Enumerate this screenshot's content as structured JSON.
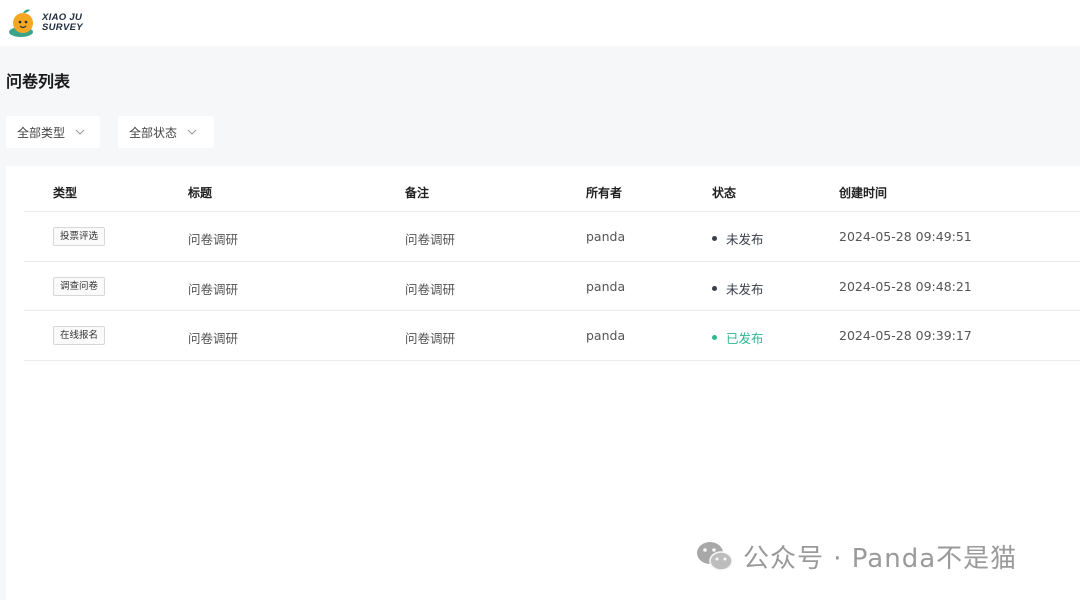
{
  "brand": {
    "line1": "XIAO JU",
    "line2": "SURVEY"
  },
  "page_title": "问卷列表",
  "filters": [
    {
      "label": "全部类型"
    },
    {
      "label": "全部状态"
    }
  ],
  "table": {
    "headers": [
      "类型",
      "标题",
      "备注",
      "所有者",
      "状态",
      "创建时间"
    ],
    "rows": [
      {
        "type": "投票评选",
        "title": "问卷调研",
        "remark": "问卷调研",
        "owner": "panda",
        "status": "未发布",
        "created": "2024-05-28 09:49:51"
      },
      {
        "type": "调查问卷",
        "title": "问卷调研",
        "remark": "问卷调研",
        "owner": "panda",
        "status": "未发布",
        "created": "2024-05-28 09:48:21"
      },
      {
        "type": "在线报名",
        "title": "问卷调研",
        "remark": "问卷调研",
        "owner": "panda",
        "status": "已发布",
        "created": "2024-05-28 09:39:17"
      }
    ]
  },
  "status_colors": {
    "未发布": "#3a3f4b",
    "已发布": "#2db890"
  },
  "watermark": "公众号 · Panda不是猫",
  "icons": {
    "logo": "orange-mascot-icon",
    "filter_arrow": "chevron-down-icon",
    "watermark": "wechat-icon"
  }
}
